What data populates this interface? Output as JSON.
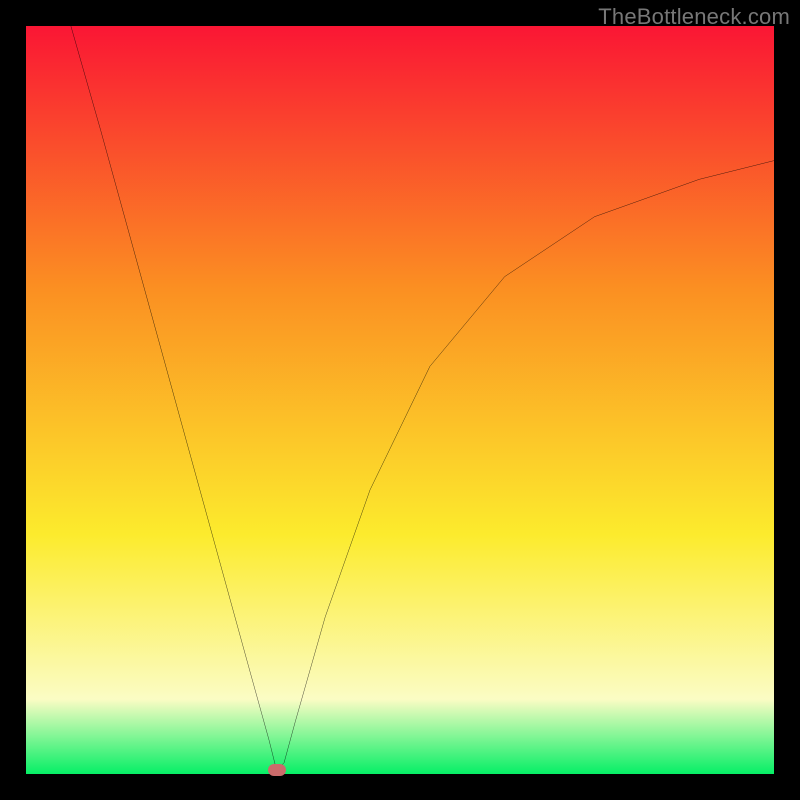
{
  "watermark": "TheBottleneck.com",
  "chart_data": {
    "type": "line",
    "title": "",
    "xlabel": "",
    "ylabel": "",
    "xlim": [
      0,
      100
    ],
    "ylim": [
      0,
      100
    ],
    "grid": false,
    "legend": false,
    "background_gradient": {
      "top": "#fa1634",
      "mid_upper": "#fb8f22",
      "mid": "#fceb2d",
      "mid_lower": "#fbfcc4",
      "bottom": "#06ef66"
    },
    "series": [
      {
        "name": "curve",
        "color": "#000000",
        "x": [
          6,
          10,
          14,
          18,
          22,
          26,
          30,
          32.5,
          33.5,
          34.5,
          36,
          40,
          46,
          54,
          64,
          76,
          90,
          100
        ],
        "values": [
          100,
          86,
          71.5,
          57,
          42.5,
          28,
          13.5,
          4.5,
          0.5,
          1.5,
          7,
          21,
          38,
          54.5,
          66.5,
          74.5,
          79.5,
          82
        ]
      }
    ],
    "marker": {
      "name": "minimum-point",
      "x": 33.5,
      "y": 0.5,
      "color": "#cb6b6b"
    }
  }
}
